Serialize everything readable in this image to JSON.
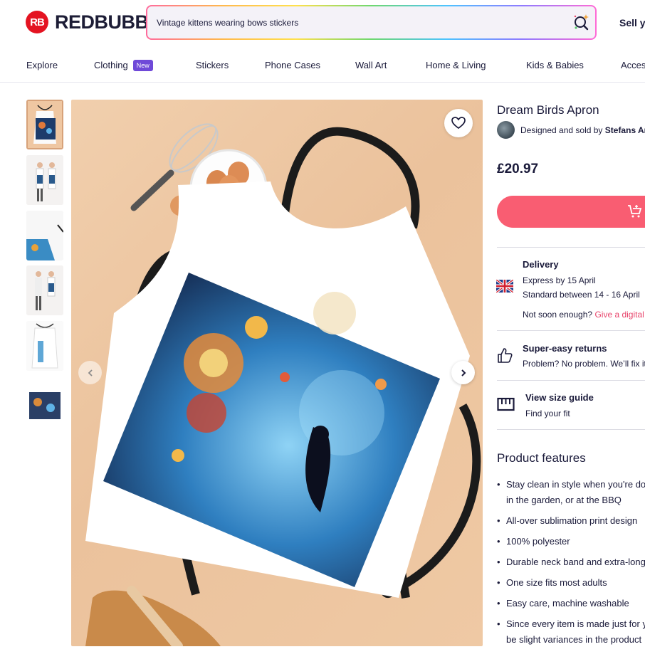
{
  "header": {
    "logo_mark": "RB",
    "logo_text": "REDBUBBLE",
    "search_value": "Vintage kittens wearing bows stickers",
    "sell_label": "Sell yo"
  },
  "nav": {
    "items": [
      "Explore",
      "Clothing",
      "Stickers",
      "Phone Cases",
      "Wall Art",
      "Home & Living",
      "Kids & Babies",
      "Acces"
    ],
    "new_badge": "New"
  },
  "product": {
    "title": "Dream Birds Apron",
    "seller_prefix": "Designed and sold by",
    "seller_name": "Stefans Arts",
    "price": "£20.97"
  },
  "delivery": {
    "title": "Delivery",
    "express": "Express by 15 April",
    "standard": "Standard between 14 - 16 April",
    "not_soon": "Not soon enough?",
    "gift_link": "Give a digital"
  },
  "returns": {
    "title": "Super-easy returns",
    "text": "Problem? No problem. We’ll fix it,"
  },
  "size_guide": {
    "title": "View size guide",
    "text": "Find your fit"
  },
  "features": {
    "title": "Product features",
    "items": [
      [
        "Stay clean in style when you're do",
        "in the garden, or at the BBQ"
      ],
      [
        "All-over sublimation print design"
      ],
      [
        "100% polyester"
      ],
      [
        "Durable neck band and extra-long"
      ],
      [
        "One size fits most adults"
      ],
      [
        "Easy care, machine washable"
      ],
      [
        "Since every item is made just for y",
        "be slight variances in the product"
      ]
    ]
  },
  "colors": {
    "brand_red": "#e41321",
    "cart_pink": "#f95d72",
    "new_badge": "#6f49d8",
    "link_pink": "#e8436a"
  }
}
